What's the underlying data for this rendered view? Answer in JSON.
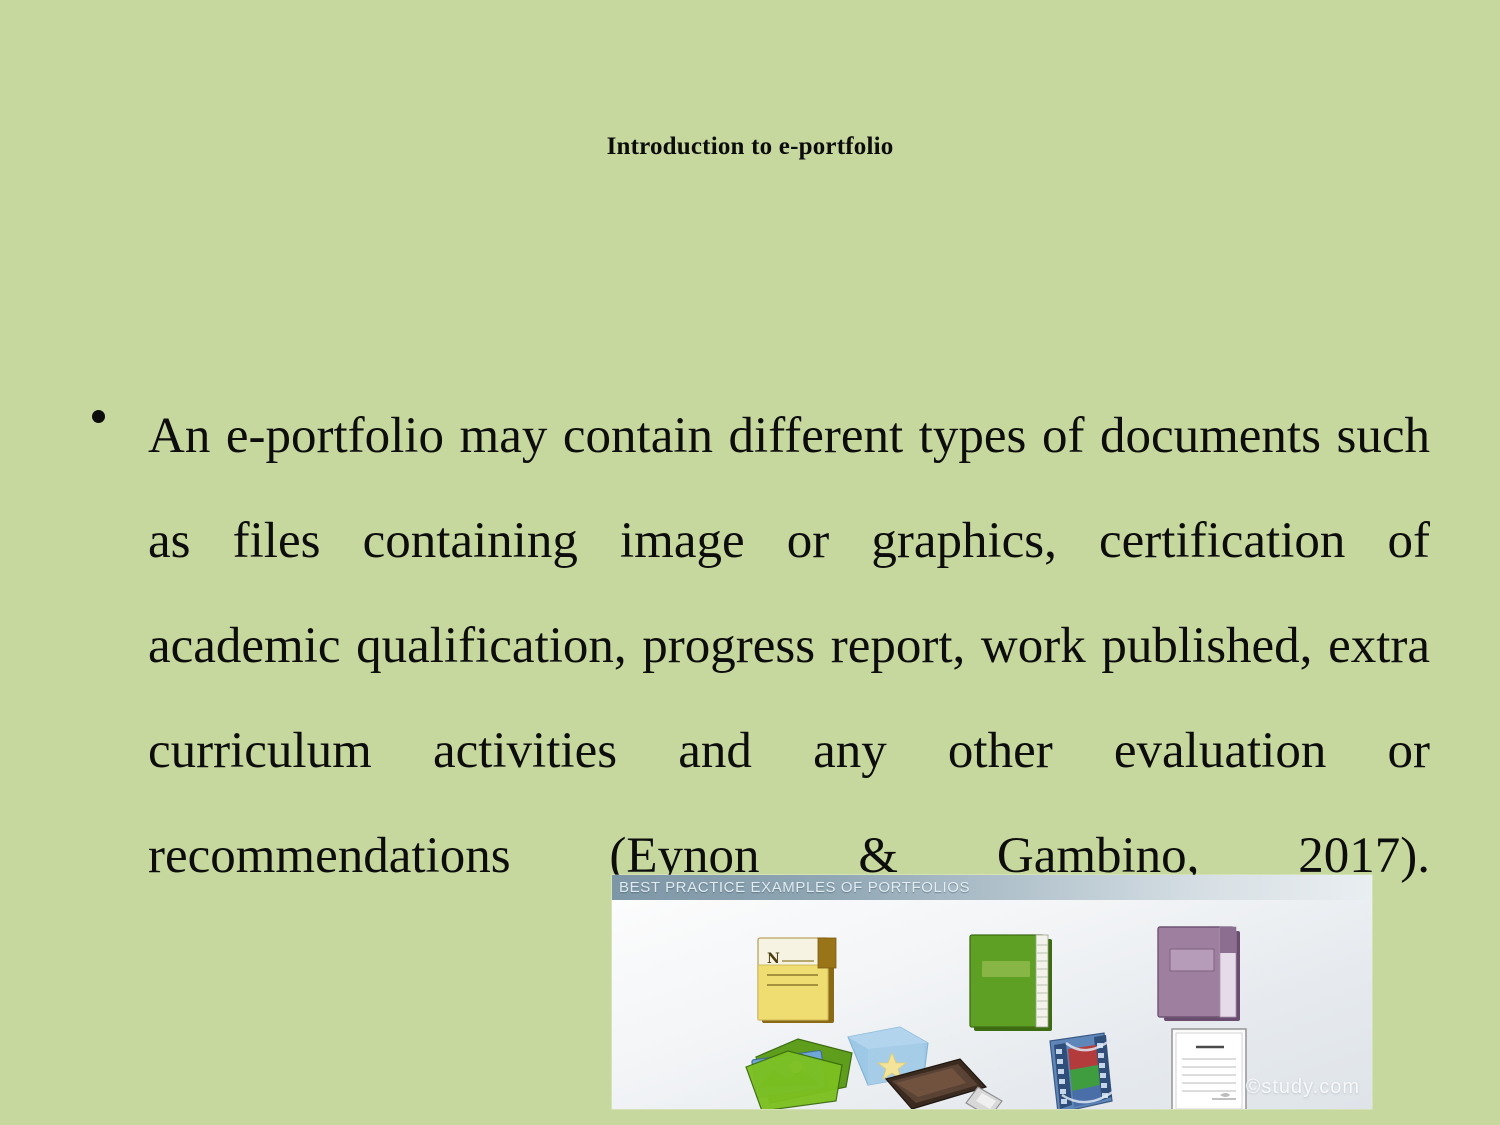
{
  "slide": {
    "background_color": "#c7d89f",
    "title": "Introduction to e-portfolio",
    "bullets": [
      "An e-portfolio may contain different types of documents such as files containing image or graphics, certification of academic qualification, progress report, work published, extra curriculum activities and any other evaluation or recommendations (Eynon & Gambino, 2017)."
    ],
    "text_color": "#0d0d0d"
  },
  "embedded_image": {
    "banner_text": "BEST PRACTICE EXAMPLES OF PORTFOLIOS",
    "banner_text_color": "#e8f2f8",
    "watermark": "©study.com",
    "background_color": "#f3f5f7",
    "icons": [
      {
        "name": "yellow-notebook-icon",
        "label": "yellow notebook",
        "color": "#e8d46a"
      },
      {
        "name": "blue-folder-star-icon",
        "label": "blue folder with star",
        "color": "#a8cde6"
      },
      {
        "name": "green-notebook-icon",
        "label": "green notebook",
        "color": "#5da024"
      },
      {
        "name": "purple-notebook-icon",
        "label": "purple notebook",
        "color": "#9e7fa0"
      },
      {
        "name": "green-photo-folder-icon",
        "label": "green folder with photo",
        "color": "#7cb342"
      },
      {
        "name": "usb-flash-drive-icon",
        "label": "usb flash drive",
        "color": "#4a3226"
      },
      {
        "name": "film-strip-icon",
        "label": "film strip",
        "color": "#5a7fb0"
      },
      {
        "name": "certificate-document-icon",
        "label": "certificate document",
        "color": "#f7f7f7"
      }
    ]
  }
}
